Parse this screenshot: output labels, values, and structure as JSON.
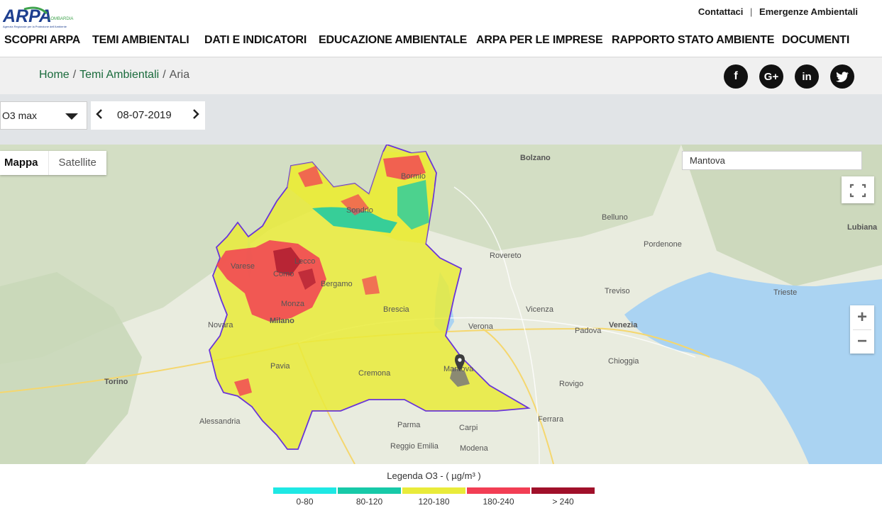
{
  "header": {
    "logo_text": "ARPA",
    "logo_sub": "LOMBARDIA",
    "logo_tagline": "Agenzia Regionale per la Protezione dell'Ambiente",
    "top_links": [
      "Contattaci",
      "Emergenze Ambientali"
    ]
  },
  "nav": {
    "items": [
      "SCOPRI ARPA",
      "TEMI AMBIENTALI",
      "DATI E INDICATORI",
      "EDUCAZIONE AMBIENTALE",
      "ARPA PER LE IMPRESE",
      "RAPPORTO STATO AMBIENTE",
      "DOCUMENTI"
    ]
  },
  "breadcrumb": {
    "home": "Home",
    "section": "Temi Ambientali",
    "current": "Aria"
  },
  "social": {
    "facebook": "f",
    "google": "G+",
    "linkedin": "in",
    "twitter": "t"
  },
  "controls": {
    "pollutant": "O3 max",
    "date": "08-07-2019",
    "prev": "‹",
    "next": "›"
  },
  "map": {
    "tabs": [
      "Mappa",
      "Satellite"
    ],
    "search_value": "Mantova",
    "zoom_in": "+",
    "zoom_out": "−",
    "labels": {
      "milano": "Milano",
      "monza": "Monza",
      "bergamo": "Bergamo",
      "brescia": "Brescia",
      "cremona": "Cremona",
      "pavia": "Pavia",
      "mantova": "Mantova",
      "verona": "Verona",
      "venezia": "Venezia",
      "torino": "Torino",
      "novara": "Novara",
      "padova": "Padova",
      "vicenza": "Vicenza",
      "treviso": "Treviso",
      "trieste": "Trieste",
      "modena": "Modena",
      "parma": "Parma",
      "lecco": "Lecco",
      "como": "Como",
      "varese": "Varese",
      "sondrio": "Sondrio",
      "bormio": "Bormio",
      "bolzano": "Bolzano",
      "belluno": "Belluno",
      "rovigo": "Rovigo",
      "ferrara": "Ferrara",
      "chioggia": "Chioggia",
      "alessandria": "Alessandria",
      "lubiana": "Lubiana",
      "reggio_emilia": "Reggio Emilia",
      "carpi": "Carpi",
      "rovereto": "Rovereto",
      "pordenone": "Pordenone"
    }
  },
  "legend": {
    "title": "Legenda O3 - ( µg/m³ )",
    "items": [
      {
        "label": "0-80",
        "color": "#1ee8e4"
      },
      {
        "label": "80-120",
        "color": "#17c9a8"
      },
      {
        "label": "120-180",
        "color": "#e9eb3a"
      },
      {
        "label": "180-240",
        "color": "#f23e54"
      },
      {
        "label": "> 240",
        "color": "#a0102a"
      }
    ]
  }
}
